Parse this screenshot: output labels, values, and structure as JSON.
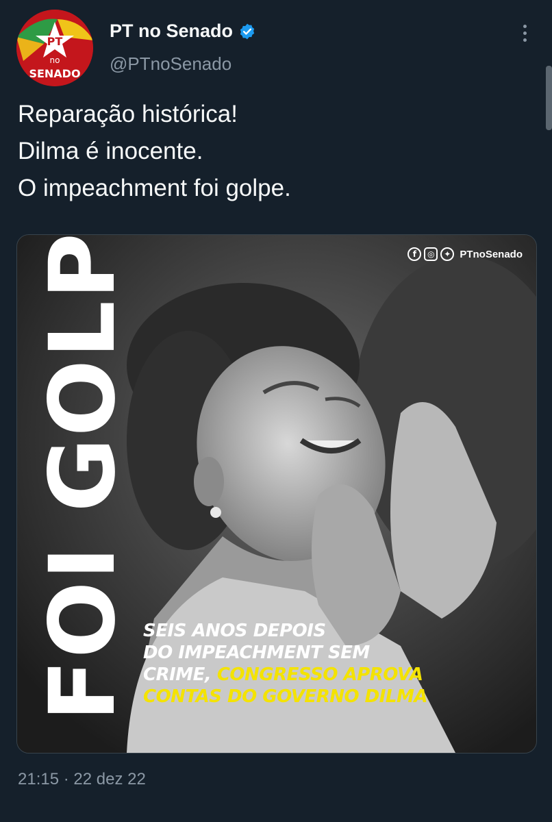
{
  "author": {
    "display_name": "PT no Senado",
    "handle": "@PTnoSenado",
    "verified": true,
    "avatar": {
      "line1": "PT",
      "line2": "no",
      "line3": "SENADO"
    }
  },
  "tweet": {
    "lines": [
      "Reparação histórica!",
      "Dilma é inocente.",
      "O impeachment foi golpe."
    ],
    "timestamp": "21:15 · 22 dez 22"
  },
  "media": {
    "vertical_title": "FOI GOLPE",
    "social_handle": "PTnoSenado",
    "social_icons": [
      "facebook-icon",
      "instagram-icon",
      "twitter-icon"
    ],
    "headline": {
      "line1": "SEIS ANOS DEPOIS",
      "line2": "DO IMPEACHMENT SEM",
      "line3_white": "CRIME, ",
      "line3_yellow": "CONGRESSO APROVA",
      "line4_yellow": "CONTAS DO GOVERNO DILMA"
    }
  },
  "colors": {
    "background": "#15202b",
    "text_primary": "#f7f9f9",
    "text_secondary": "#8b98a5",
    "verified_blue": "#1d9bf0",
    "highlight_yellow": "#f4e300",
    "brand_red": "#c4161c"
  }
}
